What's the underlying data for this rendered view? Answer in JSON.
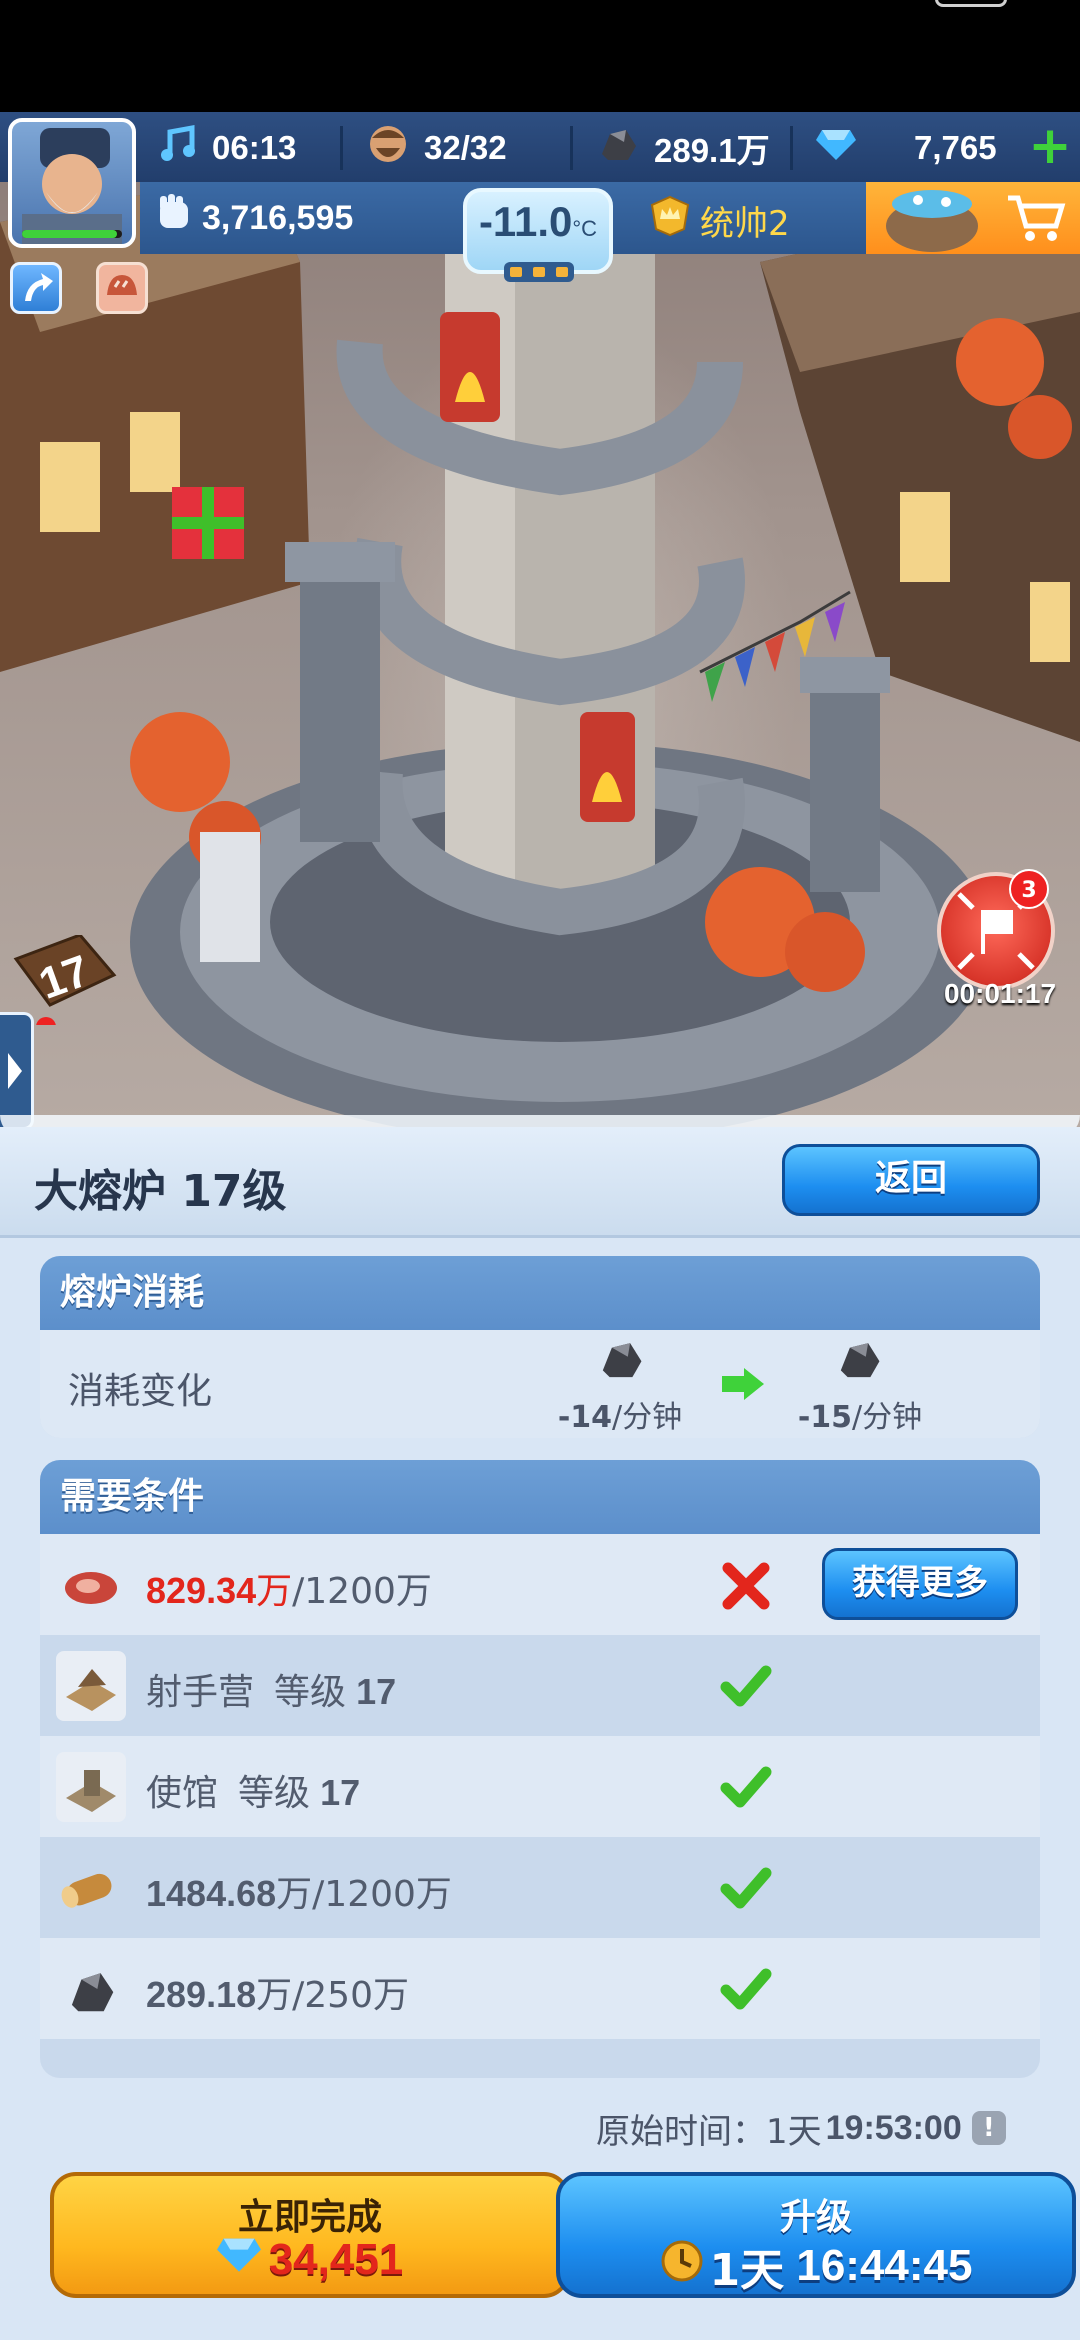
{
  "hud": {
    "music_timer": "06:13",
    "population": "32/32",
    "coal": "289.1万",
    "gems": "7,765",
    "power": "3,716,595",
    "temperature": "-11.0",
    "temperature_unit": "°C",
    "commander": "统帅2"
  },
  "scene": {
    "level_sign": "17",
    "event_count": "3",
    "event_timer": "00:01:17"
  },
  "panel": {
    "title": "大熔炉  17级",
    "back_label": "返回"
  },
  "consumption": {
    "header": "熔炉消耗",
    "label": "消耗变化",
    "before_value": "-14",
    "before_unit": "/分钟",
    "after_value": "-15",
    "after_unit": "/分钟"
  },
  "requirements": {
    "header": "需要条件",
    "more_label": "获得更多",
    "rows": [
      {
        "icon": "meat-icon",
        "have": "829.34",
        "have_unit": "万",
        "need": "/1200万",
        "met": false
      },
      {
        "icon": "archer-camp-icon",
        "name": "射手营",
        "level_label": "等级",
        "level": "17",
        "met": true
      },
      {
        "icon": "embassy-icon",
        "name": "使馆",
        "level_label": "等级",
        "level": "17",
        "met": true
      },
      {
        "icon": "wood-icon",
        "have": "1484.68",
        "have_unit": "万",
        "need": "/1200万",
        "met": true
      },
      {
        "icon": "coal-icon",
        "have": "289.18",
        "have_unit": "万",
        "need": "/250万",
        "met": true
      }
    ]
  },
  "footer": {
    "orig_time_label": "原始时间：",
    "orig_time_day": "1天",
    "orig_time_value": "19:53:00",
    "finish_label": "立即完成",
    "finish_cost": "34,451",
    "upgrade_label": "升级",
    "upgrade_day": "1天",
    "upgrade_time": "16:44:45"
  },
  "colors": {
    "hud_bar": "#2e4f82",
    "panel_bg": "#d9e6f5",
    "card_header": "#6d9fd6",
    "blue_button": "#1d8ef0",
    "yellow_button": "#ffb81f",
    "warning_red": "#e3261c",
    "check_green": "#3fbf2a"
  }
}
